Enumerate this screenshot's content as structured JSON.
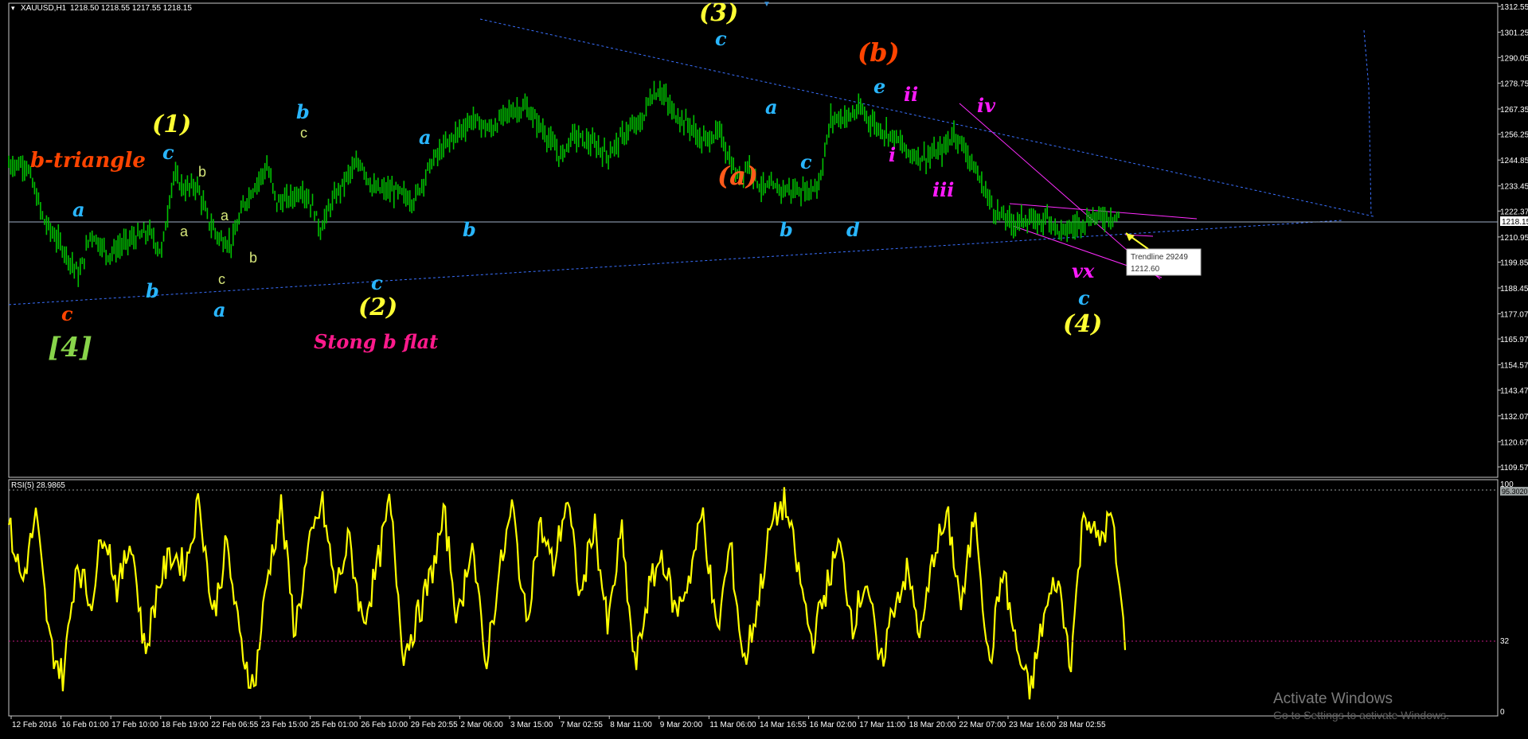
{
  "header": {
    "symbol": "XAUUSD,H1",
    "ohlc": "1218.50 1218.55 1217.55 1218.15",
    "rsi_label": "RSI(5) 28.9865"
  },
  "colors": {
    "background": "#000000",
    "candles": "#00c000",
    "rsi": "#ffff00",
    "trendline": "#3a70ff",
    "channel": "#ff2cff",
    "yellow": "#ffff33",
    "cyan": "#29b6ff",
    "orange": "#ff4400",
    "magenta": "#ff1aff",
    "lime": "#88d44a",
    "small": "#d6e67a"
  },
  "chart_data": [
    {
      "type": "candlestick",
      "symbol": "XAUUSD",
      "timeframe": "H1",
      "ylim": [
        1105,
        1314
      ],
      "y_ticks": [
        "1312.55",
        "1301.25",
        "1290.05",
        "1278.75",
        "1267.35",
        "1256.25",
        "1244.85",
        "1233.45",
        "1222.37",
        "1218.15",
        "1210.95",
        "1199.85",
        "1188.45",
        "1177.07",
        "1165.97",
        "1154.57",
        "1143.47",
        "1132.07",
        "1120.67",
        "1109.57"
      ],
      "x_labels": [
        "12 Feb 2016",
        "16 Feb 01:00",
        "17 Feb 10:00",
        "18 Feb 19:00",
        "22 Feb 06:55",
        "23 Feb 15:00",
        "25 Feb 01:00",
        "26 Feb 10:00",
        "29 Feb 20:55",
        "2 Mar 06:00",
        "3 Mar 15:00",
        "7 Mar 02:55",
        "8 Mar 11:00",
        "9 Mar 20:00",
        "11 Mar 06:00",
        "14 Mar 16:55",
        "16 Mar 02:00",
        "17 Mar 11:00",
        "18 Mar 20:00",
        "22 Mar 07:00",
        "23 Mar 16:00",
        "28 Mar 02:55"
      ],
      "close_path": [
        [
          0,
          1243
        ],
        [
          0.015,
          1243
        ],
        [
          0.03,
          1218
        ],
        [
          0.045,
          1207
        ],
        [
          0.06,
          1194
        ],
        [
          0.07,
          1213
        ],
        [
          0.085,
          1203
        ],
        [
          0.095,
          1207
        ],
        [
          0.105,
          1210
        ],
        [
          0.12,
          1213
        ],
        [
          0.13,
          1204
        ],
        [
          0.14,
          1238
        ],
        [
          0.15,
          1232
        ],
        [
          0.16,
          1234
        ],
        [
          0.17,
          1218
        ],
        [
          0.18,
          1210
        ],
        [
          0.19,
          1208
        ],
        [
          0.2,
          1225
        ],
        [
          0.21,
          1234
        ],
        [
          0.22,
          1242
        ],
        [
          0.228,
          1226
        ],
        [
          0.24,
          1228
        ],
        [
          0.25,
          1232
        ],
        [
          0.26,
          1223
        ],
        [
          0.265,
          1214
        ],
        [
          0.275,
          1226
        ],
        [
          0.29,
          1239
        ],
        [
          0.3,
          1244
        ],
        [
          0.31,
          1232
        ],
        [
          0.33,
          1231
        ],
        [
          0.345,
          1227
        ],
        [
          0.36,
          1244
        ],
        [
          0.38,
          1256
        ],
        [
          0.395,
          1263
        ],
        [
          0.41,
          1258
        ],
        [
          0.425,
          1266
        ],
        [
          0.44,
          1268
        ],
        [
          0.455,
          1258
        ],
        [
          0.47,
          1246
        ],
        [
          0.48,
          1256
        ],
        [
          0.5,
          1251
        ],
        [
          0.51,
          1247
        ],
        [
          0.525,
          1257
        ],
        [
          0.54,
          1262
        ],
        [
          0.545,
          1272
        ],
        [
          0.555,
          1276
        ],
        [
          0.565,
          1266
        ],
        [
          0.58,
          1260
        ],
        [
          0.59,
          1253
        ],
        [
          0.605,
          1257
        ],
        [
          0.62,
          1237
        ],
        [
          0.63,
          1243
        ],
        [
          0.64,
          1233
        ],
        [
          0.66,
          1232
        ],
        [
          0.68,
          1231
        ],
        [
          0.69,
          1235
        ],
        [
          0.7,
          1263
        ],
        [
          0.715,
          1264
        ],
        [
          0.725,
          1267
        ],
        [
          0.74,
          1259
        ],
        [
          0.755,
          1255
        ],
        [
          0.765,
          1248
        ],
        [
          0.78,
          1246
        ],
        [
          0.795,
          1249
        ],
        [
          0.805,
          1257
        ],
        [
          0.815,
          1249
        ],
        [
          0.825,
          1238
        ],
        [
          0.84,
          1222
        ],
        [
          0.855,
          1217
        ],
        [
          0.865,
          1219
        ],
        [
          0.875,
          1217
        ],
        [
          0.885,
          1220
        ],
        [
          0.895,
          1213
        ],
        [
          0.905,
          1215
        ],
        [
          0.915,
          1218
        ],
        [
          0.925,
          1220
        ],
        [
          0.935,
          1220
        ],
        [
          0.945,
          1220
        ]
      ],
      "trendlines": [
        {
          "name": "Trendline 29249",
          "value": "1212.60"
        }
      ],
      "wave_labels": [
        "b-triangle",
        "[4]",
        "(1)",
        "(2)",
        "Stong b flat",
        "(3)",
        "(a)",
        "(b)",
        "(4)",
        "i",
        "ii",
        "iii",
        "iv",
        "vx"
      ]
    },
    {
      "type": "line",
      "name": "RSI(5)",
      "current": 28.9865,
      "ylim": [
        0,
        100
      ],
      "levels": [
        95,
        32
      ],
      "y_ticks": [
        "100",
        "95.3020",
        "32",
        "0"
      ],
      "values": [
        80,
        55,
        84,
        30,
        15,
        66,
        46,
        80,
        52,
        75,
        25,
        55,
        68,
        62,
        92,
        40,
        72,
        30,
        10,
        58,
        88,
        35,
        68,
        90,
        52,
        74,
        38,
        60,
        90,
        25,
        40,
        58,
        84,
        38,
        75,
        20,
        58,
        88,
        38,
        80,
        62,
        92,
        48,
        82,
        35,
        78,
        18,
        52,
        68,
        42,
        58,
        86,
        32,
        72,
        20,
        46,
        80,
        90,
        60,
        30,
        52,
        72,
        38,
        58,
        18,
        46,
        60,
        32,
        70,
        82,
        44,
        88,
        18,
        62,
        28,
        8,
        40,
        58,
        22,
        88,
        72,
        84,
        30
      ]
    }
  ],
  "labels": {
    "l_btri": "b-triangle",
    "l_a1": "a",
    "l_c_orange": "c",
    "l_4sq": "[4]",
    "l_b1": "b",
    "l_1": "(1)",
    "l_c1": "c",
    "l_sb1": "b",
    "l_sa1": "a",
    "l_sa2": "a",
    "l_sb2": "b",
    "l_sc1": "c",
    "l_a2": "a",
    "l_b2": "b",
    "l_sc2": "c",
    "l_c2": "c",
    "l_2": "(2)",
    "l_stong": "Stong b flat",
    "l_a3": "a",
    "l_b3": "b",
    "l_3": "(3)",
    "l_c3": "c",
    "l_a4": "a",
    "l_a_orange": "(a)",
    "l_c4": "c",
    "l_b4": "b",
    "l_d": "d",
    "l_b_orange": "(b)",
    "l_e": "e",
    "l_ii": "ii",
    "l_i": "i",
    "l_iii": "iii",
    "l_iv": "iv",
    "l_vx": "vx",
    "l_c5": "c",
    "l_4": "(4)"
  },
  "trendline_box": {
    "name": "Trendline 29249",
    "value": "1212.60"
  },
  "watermark": {
    "title": "Activate Windows",
    "subtitle": "Go to Settings to activate Windows."
  }
}
